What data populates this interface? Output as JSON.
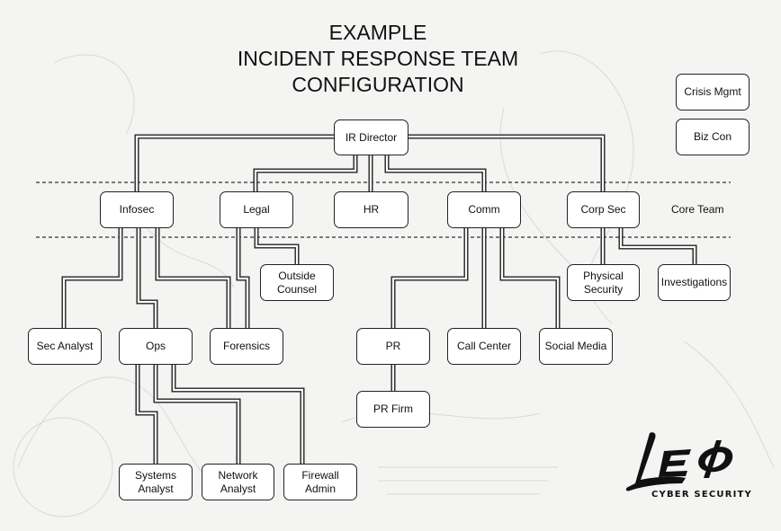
{
  "title": {
    "line1": "EXAMPLE",
    "line2": "INCIDENT RESPONSE TEAM",
    "line3": "CONFIGURATION"
  },
  "side_boxes": {
    "crisis_mgmt": "Crisis Mgmt",
    "biz_con": "Biz Con"
  },
  "core_team_label": "Core Team",
  "nodes": {
    "ir_director": "IR Director",
    "infosec": "Infosec",
    "legal": "Legal",
    "hr": "HR",
    "comm": "Comm",
    "corp_sec": "Corp Sec",
    "outside_counsel": "Outside Counsel",
    "physical_security": "Physical Security",
    "investigations": "Investigations",
    "sec_analyst": "Sec Analyst",
    "ops": "Ops",
    "forensics": "Forensics",
    "pr": "PR",
    "call_center": "Call Center",
    "social_media": "Social Media",
    "pr_firm": "PR Firm",
    "systems_analyst": "Systems Analyst",
    "network_analyst": "Network Analyst",
    "firewall_admin": "Firewall Admin"
  },
  "hierarchy": {
    "IR Director": [
      "Infosec",
      "Legal",
      "HR",
      "Comm",
      "Corp Sec"
    ],
    "Infosec": [
      "Sec Analyst",
      "Ops",
      "Forensics"
    ],
    "Legal": [
      "Forensics",
      "Outside Counsel"
    ],
    "Comm": [
      "PR",
      "Call Center",
      "Social Media"
    ],
    "PR": [
      "PR Firm"
    ],
    "Corp Sec": [
      "Physical Security",
      "Investigations"
    ],
    "Ops": [
      "Systems Analyst",
      "Network Analyst",
      "Firewall Admin"
    ]
  },
  "logo": {
    "mark": "LEO",
    "subtitle": "CYBER SECURITY"
  }
}
